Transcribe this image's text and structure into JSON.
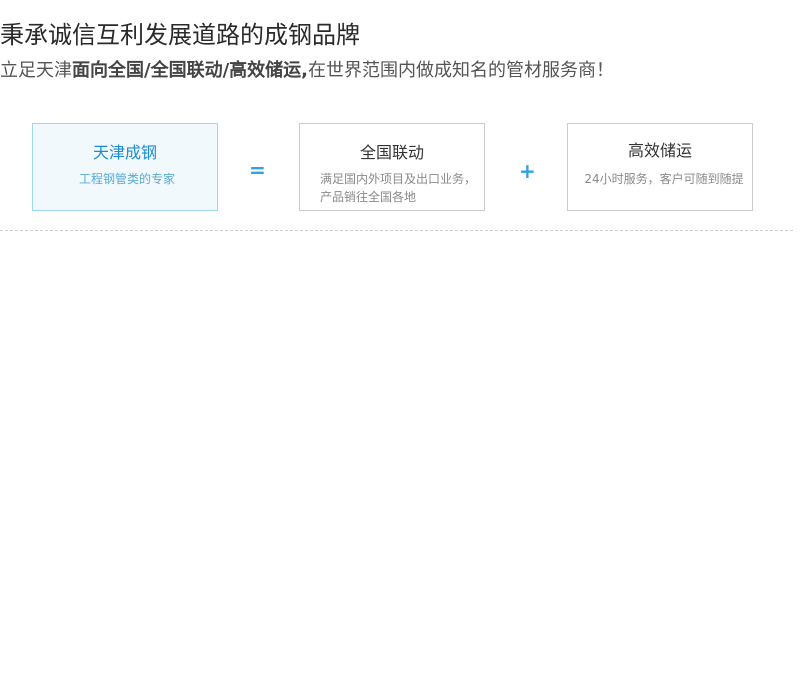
{
  "headline": "秉承诚信互利发展道路的成钢品牌",
  "subline": {
    "prefix": "立足天津",
    "highlight": "面向全国/全国联动/高效储运,",
    "suffix": "在世界范围内做成知名的管材服务商！"
  },
  "cards": [
    {
      "title": "天津成钢",
      "desc": "工程钢管类的专家"
    },
    {
      "title": "全国联动",
      "desc": "满足国内外项目及出口业务，产品销往全国各地"
    },
    {
      "title": "高效储运",
      "desc": "24小时服务，客户可随到随提"
    }
  ],
  "operators": {
    "equals": "=",
    "plus": "+"
  },
  "colors": {
    "accent": "#2ea3e0",
    "active_card_bg": "#f2f9fd",
    "active_card_border": "#9fd6f0"
  }
}
